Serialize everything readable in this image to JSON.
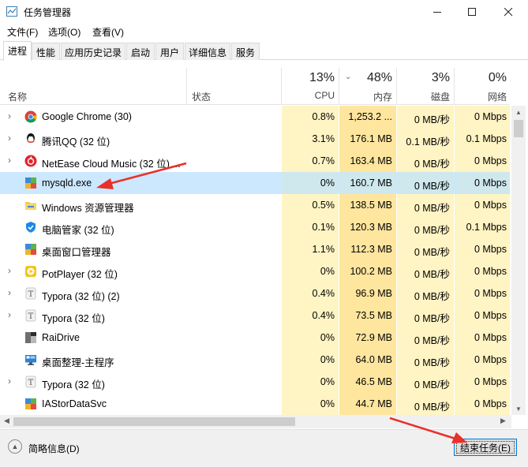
{
  "window": {
    "title": "任务管理器",
    "controls": [
      "—",
      "☐",
      "✕"
    ]
  },
  "menu": [
    "文件(F)",
    "选项(O)",
    "查看(V)"
  ],
  "tabs": [
    {
      "label": "进程",
      "active": true
    },
    {
      "label": "性能"
    },
    {
      "label": "应用历史记录"
    },
    {
      "label": "启动"
    },
    {
      "label": "用户"
    },
    {
      "label": "详细信息"
    },
    {
      "label": "服务"
    }
  ],
  "columns": {
    "name": "名称",
    "status": "状态",
    "cpu": {
      "pct": "13%",
      "label": "CPU"
    },
    "memory": {
      "pct": "48%",
      "label": "内存"
    },
    "disk": {
      "pct": "3%",
      "label": "磁盘"
    },
    "network": {
      "pct": "0%",
      "label": "网络"
    }
  },
  "processes": [
    {
      "name": "Google Chrome (30)",
      "icon": "chrome-icon",
      "expandable": true,
      "cpu": "0.8%",
      "memory": "1,253.2 ...",
      "disk": "0 MB/秒",
      "network": "0 Mbps"
    },
    {
      "name": "腾讯QQ (32 位)",
      "icon": "qq-icon",
      "expandable": true,
      "cpu": "3.1%",
      "memory": "176.1 MB",
      "disk": "0.1 MB/秒",
      "network": "0.1 Mbps"
    },
    {
      "name": "NetEase Cloud Music (32 位) ...",
      "icon": "netease-music-icon",
      "expandable": true,
      "cpu": "0.7%",
      "memory": "163.4 MB",
      "disk": "0 MB/秒",
      "network": "0 Mbps"
    },
    {
      "name": "mysqld.exe",
      "icon": "app-icon",
      "expandable": false,
      "selected": true,
      "cpu": "0%",
      "memory": "160.7 MB",
      "disk": "0 MB/秒",
      "network": "0 Mbps"
    },
    {
      "name": "Windows 资源管理器",
      "icon": "explorer-icon",
      "expandable": false,
      "cpu": "0.5%",
      "memory": "138.5 MB",
      "disk": "0 MB/秒",
      "network": "0 Mbps"
    },
    {
      "name": "电脑管家 (32 位)",
      "icon": "shield-icon",
      "expandable": false,
      "cpu": "0.1%",
      "memory": "120.3 MB",
      "disk": "0 MB/秒",
      "network": "0.1 Mbps"
    },
    {
      "name": "桌面窗口管理器",
      "icon": "app-icon",
      "expandable": false,
      "cpu": "1.1%",
      "memory": "112.3 MB",
      "disk": "0 MB/秒",
      "network": "0 Mbps"
    },
    {
      "name": "PotPlayer (32 位)",
      "icon": "potplayer-icon",
      "expandable": true,
      "cpu": "0%",
      "memory": "100.2 MB",
      "disk": "0 MB/秒",
      "network": "0 Mbps"
    },
    {
      "name": "Typora (32 位) (2)",
      "icon": "typora-icon",
      "expandable": true,
      "cpu": "0.4%",
      "memory": "96.9 MB",
      "disk": "0 MB/秒",
      "network": "0 Mbps"
    },
    {
      "name": "Typora (32 位)",
      "icon": "typora-icon",
      "expandable": true,
      "cpu": "0.4%",
      "memory": "73.5 MB",
      "disk": "0 MB/秒",
      "network": "0 Mbps"
    },
    {
      "name": "RaiDrive",
      "icon": "raidrive-icon",
      "expandable": false,
      "cpu": "0%",
      "memory": "72.9 MB",
      "disk": "0 MB/秒",
      "network": "0 Mbps"
    },
    {
      "name": "桌面整理-主程序",
      "icon": "desktop-icon",
      "expandable": false,
      "cpu": "0%",
      "memory": "64.0 MB",
      "disk": "0 MB/秒",
      "network": "0 Mbps"
    },
    {
      "name": "Typora (32 位)",
      "icon": "typora-icon",
      "expandable": true,
      "cpu": "0%",
      "memory": "46.5 MB",
      "disk": "0 MB/秒",
      "network": "0 Mbps"
    },
    {
      "name": "IAStorDataSvc",
      "icon": "app-icon",
      "expandable": false,
      "cpu": "0%",
      "memory": "44.7 MB",
      "disk": "0 MB/秒",
      "network": "0 Mbps"
    }
  ],
  "footer": {
    "fewer_details": "简略信息(D)",
    "end_task": "结束任务(E)"
  },
  "colors": {
    "selected_row": "#cce8ff",
    "cpu_heat": "#fff4c4",
    "mem_heat": "#ffe69e",
    "accent": "#0078d7",
    "annotation": "#e8312a"
  }
}
